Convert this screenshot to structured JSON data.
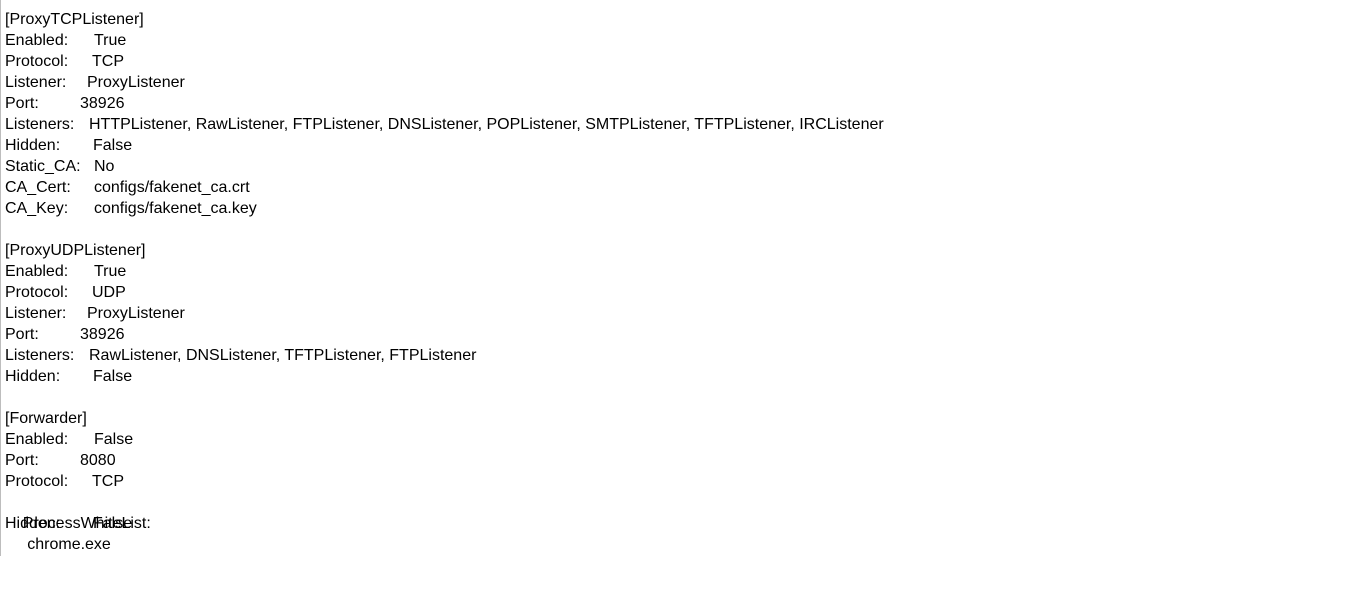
{
  "sections": [
    {
      "header": "[ProxyTCPListener]",
      "rows": [
        {
          "key": "Enabled:",
          "value": "True"
        },
        {
          "key": "Protocol:",
          "value": "TCP"
        },
        {
          "key": "Listener:",
          "value": "ProxyListener"
        },
        {
          "key": "Port:",
          "value": "38926"
        },
        {
          "key": "Listeners:",
          "value": "HTTPListener, RawListener, FTPListener, DNSListener, POPListener, SMTPListener, TFTPListener, IRCListener"
        },
        {
          "key": "Hidden:",
          "value": "False"
        },
        {
          "key": "Static_CA:",
          "value": "No"
        },
        {
          "key": "CA_Cert:",
          "value": "configs/fakenet_ca.crt"
        },
        {
          "key": "CA_Key:",
          "value": "configs/fakenet_ca.key"
        }
      ]
    },
    {
      "header": "[ProxyUDPListener]",
      "rows": [
        {
          "key": "Enabled:",
          "value": "True"
        },
        {
          "key": "Protocol:",
          "value": "UDP"
        },
        {
          "key": "Listener:",
          "value": "ProxyListener"
        },
        {
          "key": "Port:",
          "value": "38926"
        },
        {
          "key": "Listeners:",
          "value": "RawListener, DNSListener, TFTPListener, FTPListener"
        },
        {
          "key": "Hidden:",
          "value": "False"
        }
      ]
    },
    {
      "header": "[Forwarder]",
      "rows": [
        {
          "key": "Enabled:",
          "value": "False"
        },
        {
          "key": "Port:",
          "value": "8080"
        },
        {
          "key": "Protocol:",
          "value": "TCP"
        },
        {
          "key": "ProcessWhiteList:",
          "value": "chrome.exe"
        },
        {
          "key": "Hidden:",
          "value": "False"
        }
      ]
    }
  ]
}
